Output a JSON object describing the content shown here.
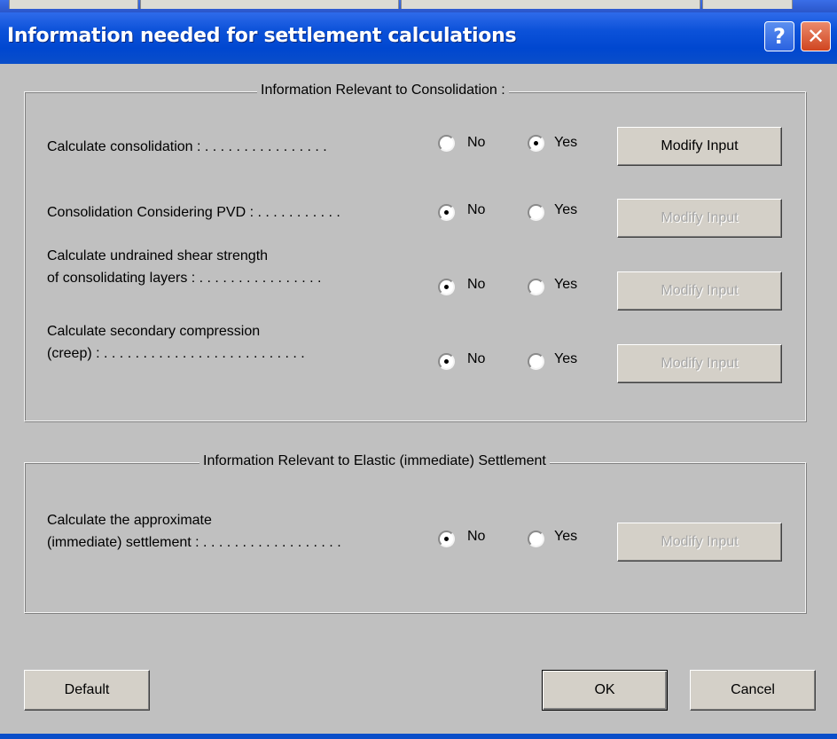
{
  "dialog": {
    "title": "Information needed for settlement calculations"
  },
  "consolidation_group": {
    "legend": "Information Relevant to Consolidation :",
    "rows": [
      {
        "label_line1": "Calculate consolidation : . . . . . . . . . . . . . . . .",
        "label_line2": "",
        "selected": "Yes",
        "button": "Modify Input",
        "button_enabled": true
      },
      {
        "label_line1": "Consolidation Considering PVD : . . . . . . . . . . .",
        "label_line2": "",
        "selected": "No",
        "button": "Modify Input",
        "button_enabled": false
      },
      {
        "label_line1": "Calculate undrained shear strength",
        "label_line2": "of consolidating layers : . . . . . . . . . . . . . . . .",
        "selected": "No",
        "button": "Modify Input",
        "button_enabled": false
      },
      {
        "label_line1": "Calculate secondary compression",
        "label_line2": "(creep) : . . . . . . . . . . . . . . . . . . . . . . . . . .",
        "selected": "No",
        "button": "Modify Input",
        "button_enabled": false
      }
    ]
  },
  "elastic_group": {
    "legend": "Information Relevant to Elastic (immediate) Settlement",
    "rows": [
      {
        "label_line1": "Calculate the approximate",
        "label_line2": "(immediate) settlement : . . . . . . . . . . . . . . . . . .",
        "selected": "No",
        "button": "Modify Input",
        "button_enabled": false
      }
    ]
  },
  "radio_labels": {
    "no": "No",
    "yes": "Yes"
  },
  "footer": {
    "default_label": "Default",
    "ok_label": "OK",
    "cancel_label": "Cancel"
  },
  "titlebar_buttons": {
    "help": "?",
    "close": "✕"
  },
  "colors": {
    "titlebar": "#0047d0",
    "face": "#c0c0c0",
    "close": "#d0451f"
  }
}
